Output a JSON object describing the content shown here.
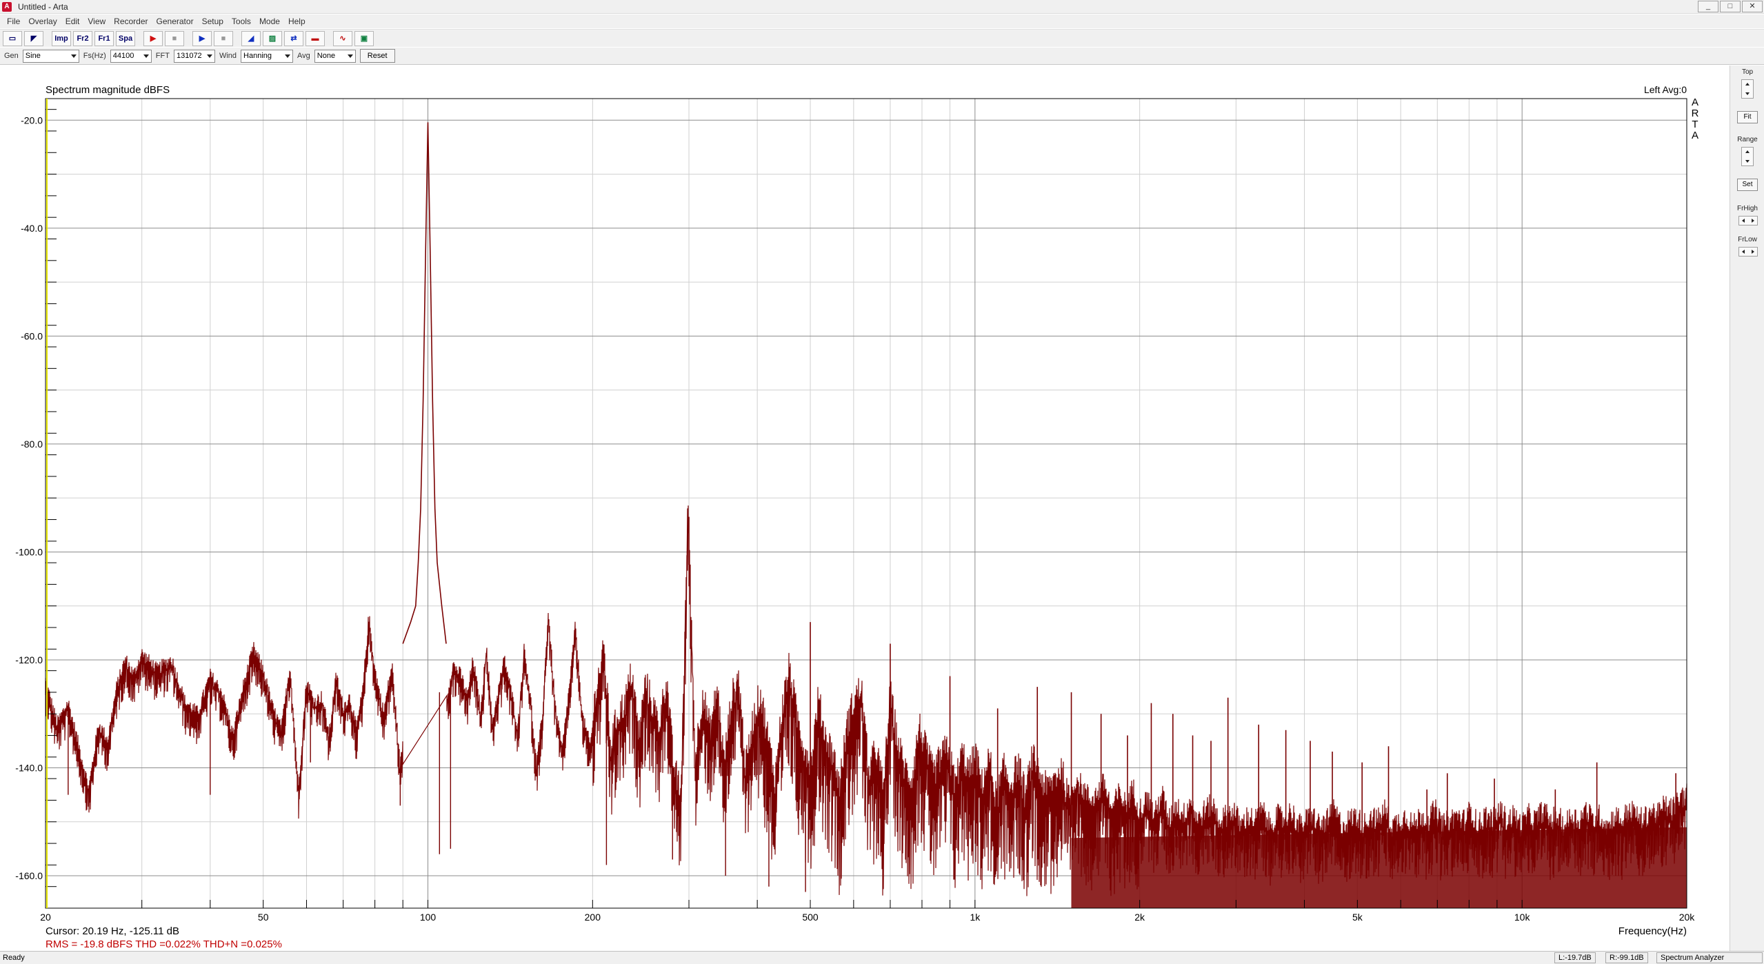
{
  "window": {
    "title": "Untitled - Arta",
    "controls": [
      "_",
      "□",
      "✕"
    ]
  },
  "menu": [
    "File",
    "Overlay",
    "Edit",
    "View",
    "Recorder",
    "Generator",
    "Setup",
    "Tools",
    "Mode",
    "Help"
  ],
  "toolbar": {
    "imp": "Imp",
    "fr1": "Fr2",
    "fr2": "Fr1",
    "spa": "Spa"
  },
  "params": {
    "gen_label": "Gen",
    "gen_value": "Sine",
    "fs_label": "Fs(Hz)",
    "fs_value": "44100",
    "fft_label": "FFT",
    "fft_value": "131072",
    "wind_label": "Wind",
    "wind_value": "Hanning",
    "avg_label": "Avg",
    "avg_value": "None",
    "reset_label": "Reset"
  },
  "right_panel": {
    "top_label": "Top",
    "fit_label": "Fit",
    "range_label": "Range",
    "set_label": "Set",
    "frhigh_label": "FrHigh",
    "frlow_label": "FrLow"
  },
  "plot": {
    "title": "Spectrum magnitude dBFS",
    "channel_info": "Left  Avg:0",
    "logo": "ARTA",
    "cursor_text": "Cursor: 20.19 Hz, -125.11 dB",
    "measure_text": "RMS =  -19.8 dBFS   THD =0.022%   THD+N =0.025%",
    "measure_color": "#c00000",
    "trace_color": "#7a0000"
  },
  "chart_data": {
    "type": "line",
    "title": "Spectrum magnitude dBFS",
    "xlabel": "Frequency(Hz)",
    "ylabel": "",
    "xscale": "log",
    "xlim": [
      20,
      20000
    ],
    "ylim": [
      -166,
      -16
    ],
    "x_tick_labels": [
      {
        "value": 20,
        "label": "20"
      },
      {
        "value": 50,
        "label": "50"
      },
      {
        "value": 100,
        "label": "100"
      },
      {
        "value": 200,
        "label": "200"
      },
      {
        "value": 500,
        "label": "500"
      },
      {
        "value": 1000,
        "label": "1k"
      },
      {
        "value": 2000,
        "label": "2k"
      },
      {
        "value": 5000,
        "label": "5k"
      },
      {
        "value": 10000,
        "label": "10k"
      },
      {
        "value": 20000,
        "label": "20k"
      }
    ],
    "y_tick_labels": [
      {
        "value": -20,
        "label": "-20.0"
      },
      {
        "value": -40,
        "label": "-40.0"
      },
      {
        "value": -60,
        "label": "-60.0"
      },
      {
        "value": -80,
        "label": "-80.0"
      },
      {
        "value": -100,
        "label": "-100.0"
      },
      {
        "value": -120,
        "label": "-120.0"
      },
      {
        "value": -140,
        "label": "-140.0"
      },
      {
        "value": -160,
        "label": "-160.0"
      }
    ],
    "grid": true,
    "series": [
      {
        "name": "",
        "points": [
          [
            20,
            -125
          ],
          [
            21,
            -133
          ],
          [
            22,
            -129
          ],
          [
            23,
            -137
          ],
          [
            24,
            -145
          ],
          [
            25,
            -133
          ],
          [
            26,
            -136
          ],
          [
            27,
            -126
          ],
          [
            28,
            -121
          ],
          [
            29,
            -124
          ],
          [
            30,
            -120
          ],
          [
            32,
            -123
          ],
          [
            34,
            -121
          ],
          [
            36,
            -129
          ],
          [
            38,
            -131
          ],
          [
            40,
            -124
          ],
          [
            42,
            -127
          ],
          [
            44,
            -135
          ],
          [
            46,
            -126
          ],
          [
            48,
            -119
          ],
          [
            50,
            -123
          ],
          [
            52,
            -130
          ],
          [
            54,
            -134
          ],
          [
            56,
            -122
          ],
          [
            58,
            -145
          ],
          [
            60,
            -125
          ],
          [
            62,
            -129
          ],
          [
            64,
            -128
          ],
          [
            66,
            -135
          ],
          [
            68,
            -124
          ],
          [
            70,
            -130
          ],
          [
            72,
            -128
          ],
          [
            74,
            -134
          ],
          [
            76,
            -127
          ],
          [
            78,
            -113
          ],
          [
            80,
            -123
          ],
          [
            83,
            -131
          ],
          [
            86,
            -122
          ],
          [
            89,
            -141
          ],
          [
            92,
            -126
          ],
          [
            95,
            -109
          ],
          [
            98,
            -135
          ],
          [
            102,
            -115
          ],
          [
            105,
            -126
          ],
          [
            108,
            -129
          ],
          [
            111,
            -122
          ],
          [
            115,
            -124
          ],
          [
            118,
            -128
          ],
          [
            121,
            -121
          ],
          [
            125,
            -131
          ],
          [
            128,
            -118
          ],
          [
            131,
            -133
          ],
          [
            135,
            -126
          ],
          [
            138,
            -121
          ],
          [
            142,
            -127
          ],
          [
            146,
            -134
          ],
          [
            150,
            -119
          ],
          [
            154,
            -128
          ],
          [
            158,
            -141
          ],
          [
            162,
            -131
          ],
          [
            166,
            -112
          ],
          [
            171,
            -130
          ],
          [
            176,
            -138
          ],
          [
            181,
            -127
          ],
          [
            186,
            -115
          ],
          [
            192,
            -132
          ],
          [
            198,
            -137
          ],
          [
            204,
            -127
          ],
          [
            210,
            -121
          ],
          [
            216,
            -139
          ],
          [
            222,
            -133
          ],
          [
            229,
            -131
          ],
          [
            236,
            -125
          ],
          [
            243,
            -137
          ],
          [
            250,
            -127
          ],
          [
            257,
            -131
          ],
          [
            265,
            -135
          ],
          [
            273,
            -126
          ],
          [
            281,
            -142
          ],
          [
            290,
            -148
          ],
          [
            299,
            -93
          ],
          [
            308,
            -141
          ],
          [
            318,
            -129
          ],
          [
            328,
            -136
          ],
          [
            338,
            -128
          ],
          [
            348,
            -142
          ],
          [
            359,
            -130
          ],
          [
            370,
            -126
          ],
          [
            381,
            -143
          ],
          [
            393,
            -134
          ],
          [
            405,
            -129
          ],
          [
            418,
            -137
          ],
          [
            431,
            -145
          ],
          [
            444,
            -132
          ],
          [
            458,
            -124
          ],
          [
            472,
            -133
          ],
          [
            487,
            -139
          ],
          [
            502,
            -142
          ],
          [
            517,
            -130
          ],
          [
            533,
            -137
          ],
          [
            549,
            -140
          ],
          [
            566,
            -146
          ],
          [
            584,
            -135
          ],
          [
            602,
            -130
          ],
          [
            620,
            -128
          ],
          [
            640,
            -144
          ],
          [
            660,
            -139
          ],
          [
            680,
            -147
          ],
          [
            700,
            -129
          ],
          [
            722,
            -138
          ],
          [
            744,
            -143
          ],
          [
            767,
            -145
          ],
          [
            791,
            -135
          ],
          [
            815,
            -140
          ],
          [
            840,
            -144
          ],
          [
            866,
            -141
          ],
          [
            892,
            -139
          ],
          [
            920,
            -146
          ],
          [
            948,
            -140
          ],
          [
            977,
            -144
          ],
          [
            1000,
            -140
          ],
          [
            1030,
            -146
          ],
          [
            1062,
            -141
          ],
          [
            1095,
            -149
          ],
          [
            1128,
            -143
          ],
          [
            1163,
            -146
          ],
          [
            1199,
            -142
          ],
          [
            1236,
            -148
          ],
          [
            1274,
            -141
          ],
          [
            1313,
            -144
          ],
          [
            1353,
            -147
          ],
          [
            1395,
            -145
          ],
          [
            1438,
            -143
          ],
          [
            1482,
            -149
          ],
          [
            1528,
            -144
          ],
          [
            1575,
            -146
          ],
          [
            1623,
            -148
          ],
          [
            1673,
            -147
          ],
          [
            1724,
            -145
          ],
          [
            1777,
            -150
          ],
          [
            1832,
            -147
          ],
          [
            1888,
            -149
          ],
          [
            1946,
            -146
          ],
          [
            2000,
            -150
          ],
          [
            2068,
            -148
          ],
          [
            2131,
            -151
          ],
          [
            2197,
            -147
          ],
          [
            2264,
            -152
          ],
          [
            2334,
            -149
          ],
          [
            2405,
            -151
          ],
          [
            2479,
            -148
          ],
          [
            2555,
            -152
          ],
          [
            2634,
            -150
          ],
          [
            2715,
            -149
          ],
          [
            2798,
            -152
          ],
          [
            2884,
            -151
          ],
          [
            2973,
            -150
          ],
          [
            3064,
            -153
          ],
          [
            3158,
            -151
          ],
          [
            3255,
            -152
          ],
          [
            3355,
            -150
          ],
          [
            3458,
            -153
          ],
          [
            3564,
            -151
          ],
          [
            3674,
            -152
          ],
          [
            3787,
            -150
          ],
          [
            3903,
            -153
          ],
          [
            4023,
            -152
          ],
          [
            4146,
            -151
          ],
          [
            4274,
            -153
          ],
          [
            4405,
            -152
          ],
          [
            4540,
            -150
          ],
          [
            4680,
            -153
          ],
          [
            4823,
            -152
          ],
          [
            4972,
            -151
          ],
          [
            5124,
            -153
          ],
          [
            5282,
            -151
          ],
          [
            5444,
            -152
          ],
          [
            5611,
            -150
          ],
          [
            5783,
            -153
          ],
          [
            5961,
            -152
          ],
          [
            6144,
            -151
          ],
          [
            6332,
            -153
          ],
          [
            6527,
            -151
          ],
          [
            6727,
            -152
          ],
          [
            6934,
            -150
          ],
          [
            7147,
            -153
          ],
          [
            7366,
            -152
          ],
          [
            7592,
            -151
          ],
          [
            7825,
            -152
          ],
          [
            8066,
            -150
          ],
          [
            8313,
            -153
          ],
          [
            8569,
            -151
          ],
          [
            8832,
            -152
          ],
          [
            9103,
            -150
          ],
          [
            9383,
            -152
          ],
          [
            9671,
            -151
          ],
          [
            9968,
            -153
          ],
          [
            10274,
            -151
          ],
          [
            10590,
            -152
          ],
          [
            10915,
            -150
          ],
          [
            11250,
            -152
          ],
          [
            11595,
            -151
          ],
          [
            11951,
            -153
          ],
          [
            12318,
            -151
          ],
          [
            12696,
            -152
          ],
          [
            13086,
            -150
          ],
          [
            13488,
            -152
          ],
          [
            13902,
            -151
          ],
          [
            14329,
            -153
          ],
          [
            14769,
            -151
          ],
          [
            15222,
            -152
          ],
          [
            15690,
            -150
          ],
          [
            16171,
            -151
          ],
          [
            16668,
            -152
          ],
          [
            17180,
            -150
          ],
          [
            17707,
            -151
          ],
          [
            18251,
            -149
          ],
          [
            18811,
            -150
          ],
          [
            19389,
            -148
          ],
          [
            20000,
            -147
          ]
        ],
        "peaks": [
          {
            "f": 100,
            "db": -20.4
          },
          {
            "f": 300,
            "db": -93.5
          },
          {
            "f": 500,
            "db": -113
          },
          {
            "f": 700,
            "db": -117
          },
          {
            "f": 900,
            "db": -123
          },
          {
            "f": 1100,
            "db": -129
          },
          {
            "f": 1300,
            "db": -125
          },
          {
            "f": 1500,
            "db": -126
          },
          {
            "f": 1700,
            "db": -130
          },
          {
            "f": 1900,
            "db": -134
          },
          {
            "f": 2100,
            "db": -128
          },
          {
            "f": 2300,
            "db": -130
          },
          {
            "f": 2500,
            "db": -134
          },
          {
            "f": 2700,
            "db": -135
          },
          {
            "f": 2900,
            "db": -127
          },
          {
            "f": 3300,
            "db": -132
          },
          {
            "f": 3700,
            "db": -133
          },
          {
            "f": 4100,
            "db": -135
          },
          {
            "f": 4500,
            "db": -137
          },
          {
            "f": 5100,
            "db": -139
          },
          {
            "f": 5700,
            "db": -136
          },
          {
            "f": 6700,
            "db": -144
          },
          {
            "f": 7300,
            "db": -141
          },
          {
            "f": 8900,
            "db": -142
          },
          {
            "f": 11500,
            "db": -144
          },
          {
            "f": 13700,
            "db": -139
          },
          {
            "f": 19100,
            "db": -141
          }
        ],
        "dips": [
          {
            "f": 22,
            "db": -145
          },
          {
            "f": 40,
            "db": -145
          },
          {
            "f": 61,
            "db": -139
          },
          {
            "f": 89,
            "db": -147
          },
          {
            "f": 105,
            "db": -156
          },
          {
            "f": 110,
            "db": -155
          },
          {
            "f": 212,
            "db": -158
          },
          {
            "f": 280,
            "db": -157
          },
          {
            "f": 350,
            "db": -160
          },
          {
            "f": 420,
            "db": -162
          },
          {
            "f": 490,
            "db": -163
          }
        ],
        "peak_100_shape": [
          [
            90,
            -117
          ],
          [
            93,
            -113
          ],
          [
            95,
            -110
          ],
          [
            96,
            -102
          ],
          [
            97,
            -92
          ],
          [
            98,
            -72
          ],
          [
            99,
            -45
          ],
          [
            100,
            -20.4
          ],
          [
            101,
            -45
          ],
          [
            102,
            -72
          ],
          [
            103,
            -92
          ],
          [
            104,
            -102
          ],
          [
            106,
            -110
          ],
          [
            108,
            -117
          ]
        ]
      }
    ]
  }
}
